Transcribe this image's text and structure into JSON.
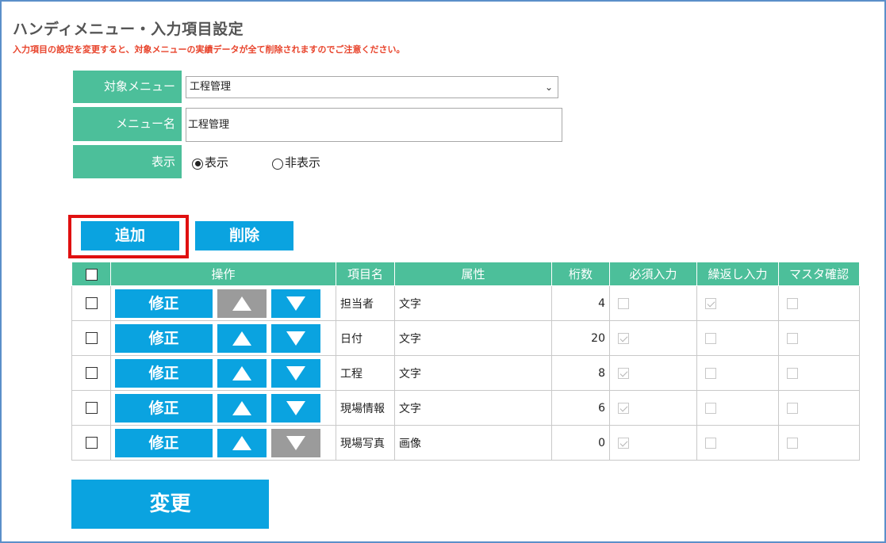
{
  "page": {
    "title": "ハンディメニュー・入力項目設定",
    "warning": "入力項目の設定を変更すると、対象メニューの実績データが全て削除されますのでご注意ください。"
  },
  "form": {
    "target_menu_label": "対象メニュー",
    "target_menu_value": "工程管理",
    "menu_name_label": "メニュー名",
    "menu_name_value": "工程管理",
    "display_label": "表示",
    "display_options": [
      "表示",
      "非表示"
    ],
    "display_selected": "表示"
  },
  "toolbar": {
    "add_label": "追加",
    "delete_label": "削除"
  },
  "table": {
    "headers": [
      "操作",
      "項目名",
      "属性",
      "桁数",
      "必須入力",
      "繰返し入力",
      "マスタ確認"
    ],
    "edit_label": "修正",
    "rows": [
      {
        "name": "担当者",
        "attr": "文字",
        "digits": "4",
        "required": false,
        "repeat": true,
        "master": false,
        "up_enabled": false,
        "down_enabled": true
      },
      {
        "name": "日付",
        "attr": "文字",
        "digits": "20",
        "required": true,
        "repeat": false,
        "master": false,
        "up_enabled": true,
        "down_enabled": true
      },
      {
        "name": "工程",
        "attr": "文字",
        "digits": "8",
        "required": true,
        "repeat": false,
        "master": false,
        "up_enabled": true,
        "down_enabled": true
      },
      {
        "name": "現場情報",
        "attr": "文字",
        "digits": "6",
        "required": true,
        "repeat": false,
        "master": false,
        "up_enabled": true,
        "down_enabled": true
      },
      {
        "name": "現場写真",
        "attr": "画像",
        "digits": "0",
        "required": true,
        "repeat": false,
        "master": false,
        "up_enabled": true,
        "down_enabled": false
      }
    ]
  },
  "footer": {
    "change_label": "変更"
  },
  "colors": {
    "header_green": "#4cbf9a",
    "button_blue": "#0aa3e0",
    "disabled_gray": "#9b9b9b",
    "warning_red": "#e8442c",
    "highlight_red": "#e01010"
  }
}
